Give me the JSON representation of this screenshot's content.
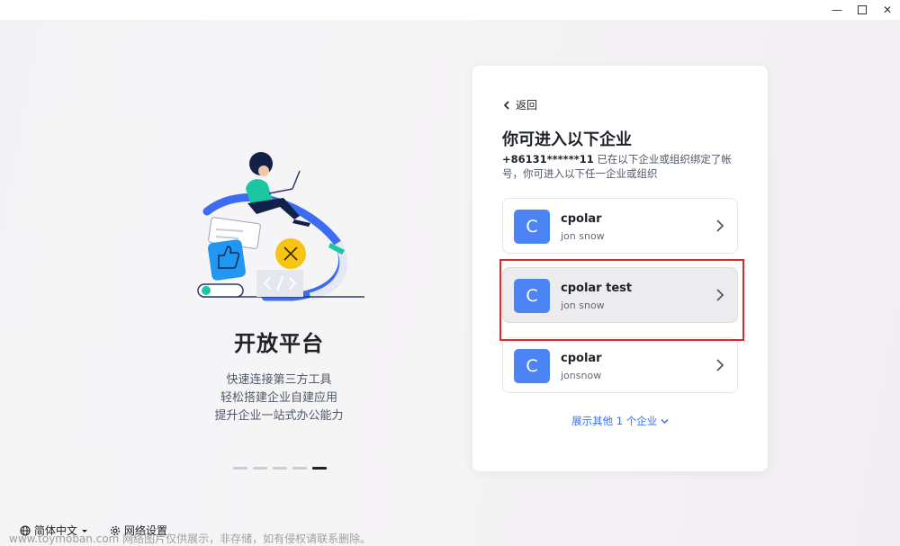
{
  "window": {
    "minimize": "—",
    "maximize": "",
    "close": "✕"
  },
  "promo": {
    "title": "开放平台",
    "lines": [
      "快速连接第三方工具",
      "轻松搭建企业自建应用",
      "提升企业一站式办公能力"
    ],
    "carousel": {
      "total": 5,
      "active_index": 4
    },
    "illustration_icons": [
      "person-laptop-illustration",
      "thumbs-up-icon",
      "close-icon",
      "code-icon"
    ]
  },
  "footer": {
    "language_label": "简体中文",
    "language_icon": "globe-icon",
    "network_label": "网络设置",
    "network_icon": "gear-icon"
  },
  "card": {
    "back_label": "返回",
    "title": "你可进入以下企业",
    "phone": "+86131******11",
    "desc_rest": " 已在以下企业或组织绑定了帐号，你可进入以下任一企业或组织",
    "orgs": [
      {
        "initial": "C",
        "name": "cpolar",
        "user": "jon snow",
        "selected": false
      },
      {
        "initial": "C",
        "name": "cpolar test",
        "user": "jon snow",
        "selected": true
      },
      {
        "initial": "C",
        "name": "cpolar",
        "user": "jonsnow",
        "selected": false
      }
    ],
    "more_prefix": "展示其他 ",
    "more_count": "1",
    "more_suffix": " 个企业",
    "accent_color": "#3370ff",
    "avatar_color": "#4c84f6"
  },
  "annotation": {
    "highlight_color": "#e0272b"
  },
  "watermark": "www.toymoban.com 网络图片仅供展示，非存储，如有侵权请联系删除。"
}
